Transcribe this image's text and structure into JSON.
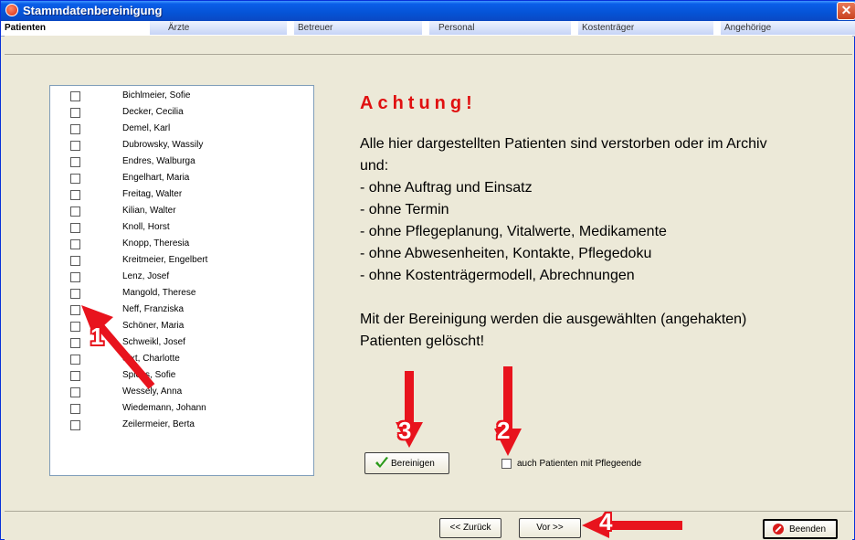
{
  "window": {
    "title": "Stammdatenbereinigung"
  },
  "tabs": [
    {
      "label": "Patienten",
      "active": true
    },
    {
      "label": "Ärzte",
      "active": false
    },
    {
      "label": "Betreuer",
      "active": false
    },
    {
      "label": "Personal",
      "active": false
    },
    {
      "label": "Kostenträger",
      "active": false
    },
    {
      "label": "Angehörige",
      "active": false
    }
  ],
  "patients": [
    {
      "name": "Bichlmeier, Sofie",
      "checked": false
    },
    {
      "name": "Decker, Cecilia",
      "checked": false
    },
    {
      "name": "Demel, Karl",
      "checked": false
    },
    {
      "name": "Dubrowsky, Wassily",
      "checked": false
    },
    {
      "name": "Endres, Walburga",
      "checked": false
    },
    {
      "name": "Engelhart, Maria",
      "checked": false
    },
    {
      "name": "Freitag, Walter",
      "checked": false
    },
    {
      "name": "Kilian, Walter",
      "checked": false
    },
    {
      "name": "Knoll, Horst",
      "checked": false
    },
    {
      "name": "Knopp, Theresia",
      "checked": false
    },
    {
      "name": "Kreitmeier, Engelbert",
      "checked": false
    },
    {
      "name": "Lenz, Josef",
      "checked": false
    },
    {
      "name": "Mangold, Therese",
      "checked": false
    },
    {
      "name": "Neff, Franziska",
      "checked": false
    },
    {
      "name": "Schöner, Maria",
      "checked": false
    },
    {
      "name": "Schweikl, Josef",
      "checked": false
    },
    {
      "name": "Sixt, Charlotte",
      "checked": false
    },
    {
      "name": "Spiess, Sofie",
      "checked": false
    },
    {
      "name": "Wessely, Anna",
      "checked": false
    },
    {
      "name": "Wiedemann, Johann",
      "checked": false
    },
    {
      "name": "Zeilermeier, Berta",
      "checked": false
    }
  ],
  "warning": {
    "title": "Achtung!",
    "lines": [
      "Alle hier dargestellten Patienten sind verstorben oder im Archiv",
      "und:",
      "- ohne Auftrag und Einsatz",
      "- ohne Termin",
      "- ohne Pflegeplanung, Vitalwerte, Medikamente",
      "- ohne Abwesenheiten, Kontakte, Pflegedoku",
      "- ohne Kostenträgermodell, Abrechnungen",
      "",
      "Mit der Bereinigung werden die ausgewählten (angehakten)",
      "Patienten gelöscht!"
    ]
  },
  "actions": {
    "bereinigen_label": "Bereinigen",
    "include_pflegeende_label": "auch Patienten mit Pflegeende",
    "include_pflegeende_checked": false,
    "back_label": "<< Zurück",
    "next_label": "Vor >>",
    "quit_label": "Beenden"
  },
  "annotations": [
    {
      "number": "1",
      "color": "#e8131d"
    },
    {
      "number": "2",
      "color": "#e8131d"
    },
    {
      "number": "3",
      "color": "#e8131d"
    },
    {
      "number": "4",
      "color": "#e8131d"
    }
  ],
  "colors": {
    "title_bar": "#0553d6",
    "warning_text": "#e01010",
    "arrow": "#e8131d",
    "check_icon": "#2a9a1a",
    "stop_icon": "#d81a1a"
  }
}
